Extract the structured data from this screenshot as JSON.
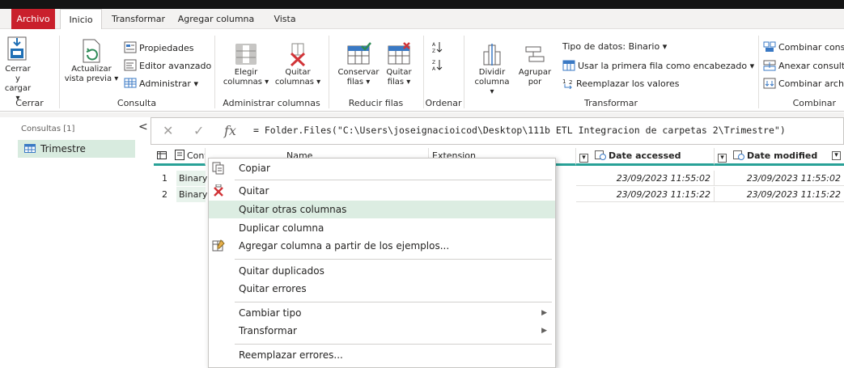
{
  "tabs": [
    "Archivo",
    "Inicio",
    "Transformar",
    "Agregar columna",
    "Vista"
  ],
  "ribbon": {
    "cerrar_cargar": [
      "Cerrar y",
      "cargar ▾"
    ],
    "actualizar": [
      "Actualizar",
      "vista previa ▾"
    ],
    "propiedades": "Propiedades",
    "editor_avanzado": "Editor avanzado",
    "administrar": "Administrar ▾",
    "elegir_columnas": [
      "Elegir",
      "columnas ▾"
    ],
    "quitar_columnas": [
      "Quitar",
      "columnas ▾"
    ],
    "conservar_filas": [
      "Conservar",
      "filas ▾"
    ],
    "quitar_filas": [
      "Quitar",
      "filas ▾"
    ],
    "dividir_columna": [
      "Dividir",
      "columna ▾"
    ],
    "agrupar_por": [
      "Agrupar",
      "por"
    ],
    "tipo_datos": "Tipo de datos: Binario ▾",
    "usar_primera_fila": "Usar la primera fila como encabezado ▾",
    "reemplazar_valores": "Reemplazar los valores",
    "combinar_cons": "Combinar cons",
    "anexar_consult": "Anexar consult",
    "combinar_archi": "Combinar archi",
    "groups": [
      "Cerrar",
      "Consulta",
      "Administrar columnas",
      "Reducir filas",
      "Ordenar",
      "Transformar",
      "Combinar"
    ]
  },
  "queries": {
    "title": "Consultas [1]",
    "collapse": "<",
    "items": [
      "Trimestre"
    ]
  },
  "formula": {
    "cancel": "✕",
    "commit": "✓",
    "fx": "fx",
    "text": "= Folder.Files(\"C:\\Users\\joseignacioicod\\Desktop\\111b ETL Integracion de carpetas 2\\Trimestre\")"
  },
  "grid": {
    "headers": [
      "Content",
      "Name",
      "Extension",
      "Date accessed",
      "Date modified"
    ],
    "header_types": [
      "",
      "ABc",
      "ABc",
      "",
      ""
    ],
    "rows": [
      {
        "num": "1",
        "content": "Binary",
        "date_accessed": "23/09/2023 11:55:02",
        "date_modified": "23/09/2023 11:55:02"
      },
      {
        "num": "2",
        "content": "Binary",
        "date_accessed": "23/09/2023 11:15:22",
        "date_modified": "23/09/2023 11:15:22"
      }
    ]
  },
  "context_menu": [
    "Copiar",
    "Quitar",
    "Quitar otras columnas",
    "Duplicar columna",
    "Agregar columna a partir de los ejemplos...",
    "Quitar duplicados",
    "Quitar errores",
    "Cambiar tipo",
    "Transformar",
    "Reemplazar errores..."
  ],
  "colors": {
    "accent": "#28a197",
    "file_tab": "#c9202c",
    "highlight": "#dcede2"
  }
}
